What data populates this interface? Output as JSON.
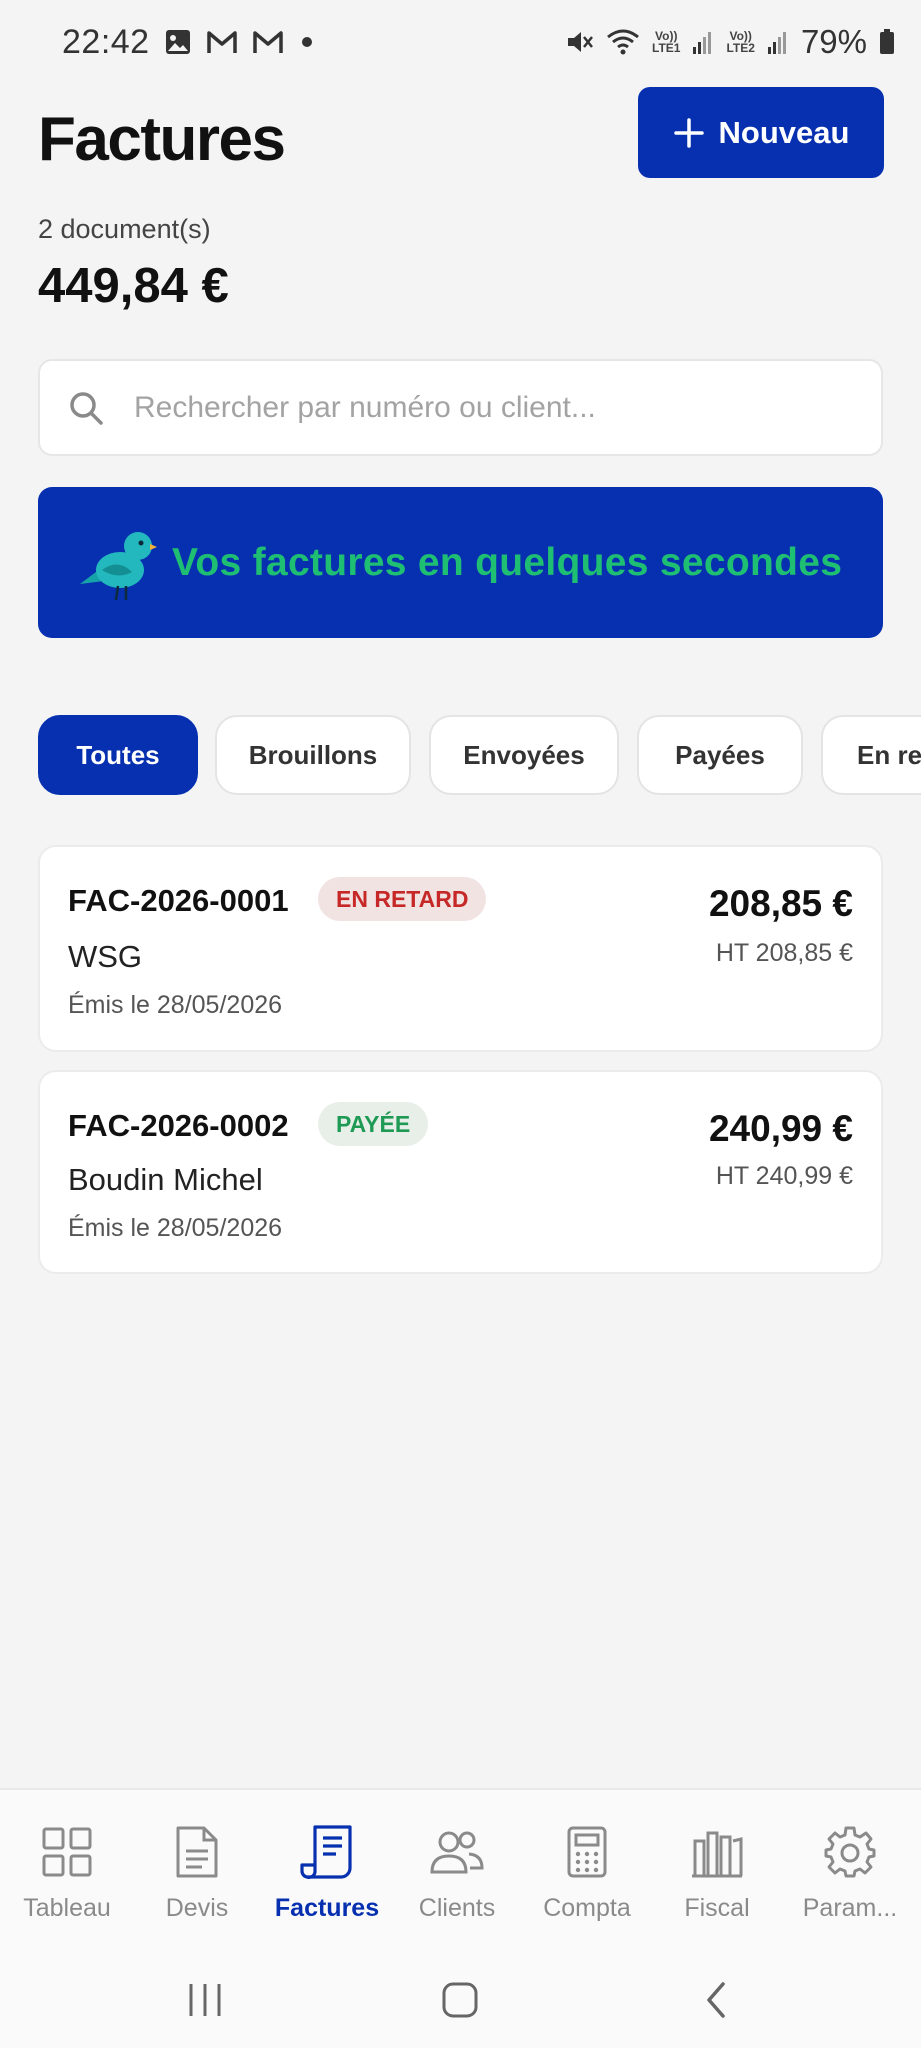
{
  "status_bar": {
    "time": "22:42",
    "battery": "79%",
    "sim1_label": [
      "Vo))",
      "LTE1"
    ],
    "sim2_label": [
      "Vo))",
      "LTE2"
    ]
  },
  "header": {
    "title": "Factures",
    "new_button_label": "Nouveau",
    "doc_count": "2 document(s)",
    "total": "449,84 €"
  },
  "search": {
    "placeholder": "Rechercher par numéro ou client...",
    "value": ""
  },
  "banner": {
    "text": "Vos factures en quelques secondes",
    "icon": "bird-icon"
  },
  "filters": {
    "active": "Toutes",
    "chips": [
      "Toutes",
      "Brouillons",
      "Envoyées",
      "Payées",
      "En re"
    ]
  },
  "invoices": [
    {
      "number": "FAC-2026-0001",
      "status": "EN RETARD",
      "client": "WSG",
      "date": "Émis le 28/05/2026",
      "amount": "208,85 €",
      "ht": "HT 208,85 €"
    },
    {
      "number": "FAC-2026-0002",
      "status": "PAYÉE",
      "client": "Boudin Michel",
      "date": "Émis le 28/05/2026",
      "amount": "240,99 €",
      "ht": "HT 240,99 €"
    }
  ],
  "bottom_nav": {
    "active": "Factures",
    "items": [
      {
        "label": "Tableau",
        "icon": "dashboard-grid-icon"
      },
      {
        "label": "Devis",
        "icon": "document-icon"
      },
      {
        "label": "Factures",
        "icon": "receipt-icon"
      },
      {
        "label": "Clients",
        "icon": "users-icon"
      },
      {
        "label": "Compta",
        "icon": "calculator-icon"
      },
      {
        "label": "Fiscal",
        "icon": "building-icon"
      },
      {
        "label": "Param...",
        "icon": "gear-icon"
      }
    ]
  },
  "colors": {
    "primary": "#0730b0",
    "banner_text": "#1fbf73",
    "late": "#c62828",
    "paid": "#1f9a55",
    "background": "#f4f4f4"
  }
}
